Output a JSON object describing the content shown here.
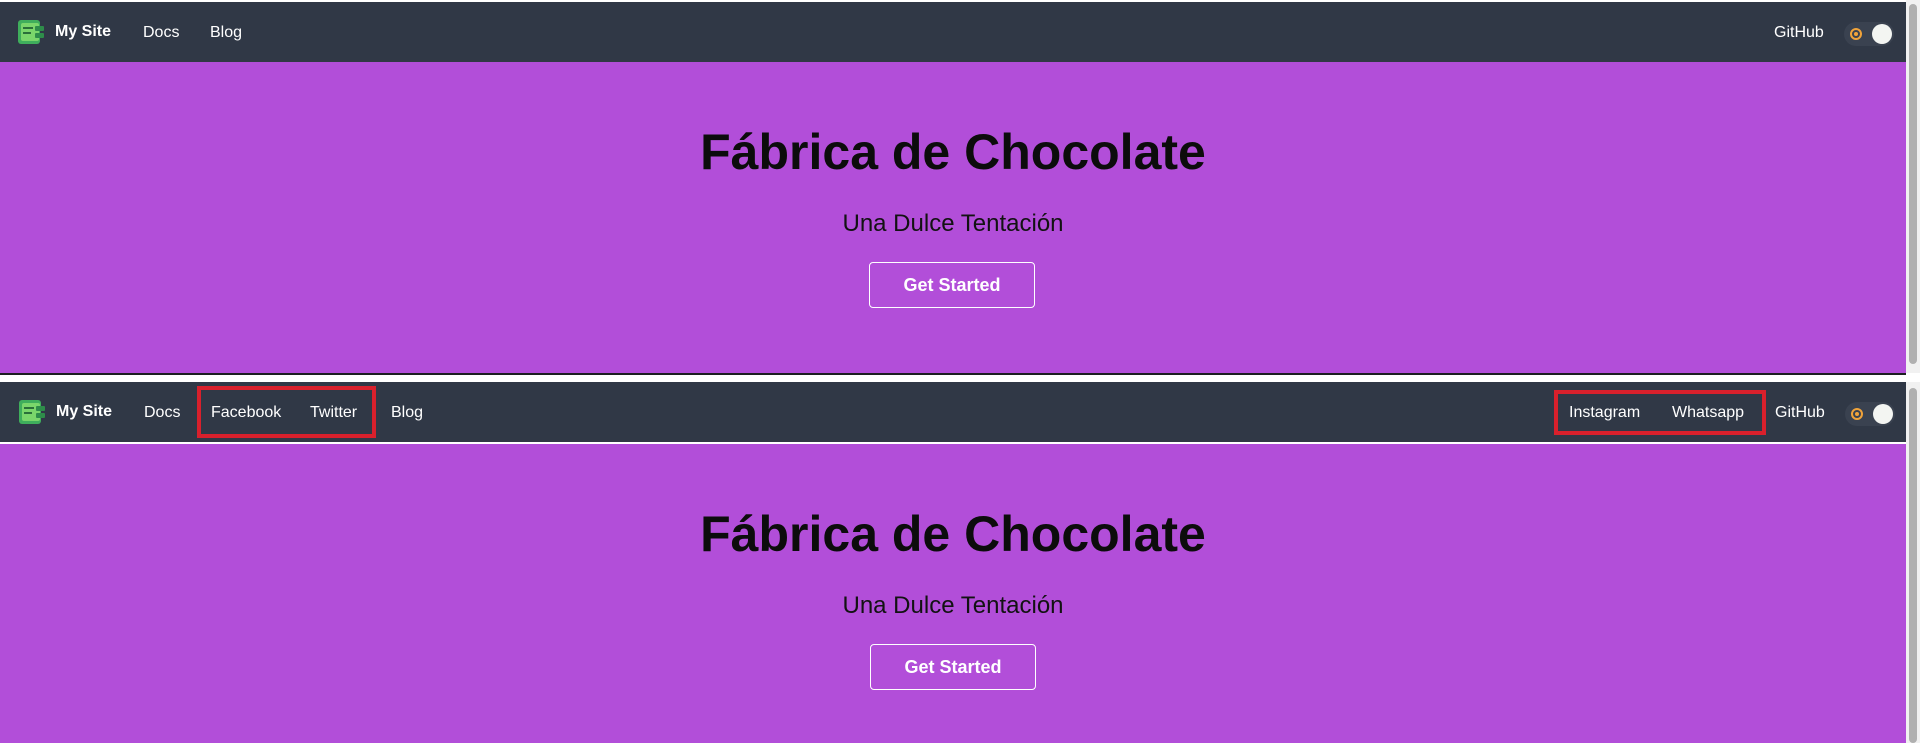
{
  "site": {
    "brand": "My Site",
    "github_label": "GitHub"
  },
  "top_view": {
    "nav_left": [
      "Docs",
      "Blog"
    ]
  },
  "bottom_view": {
    "nav_left": [
      "Docs",
      "Facebook",
      "Twitter",
      "Blog"
    ],
    "nav_right": [
      "Instagram",
      "Whatsapp"
    ]
  },
  "hero": {
    "title": "Fábrica de Chocolate",
    "subtitle": "Una Dulce Tentación",
    "button_label": "Get Started"
  },
  "colors": {
    "navbar_bg": "#303846",
    "hero_bg": "#b24ed9",
    "highlight": "#d9202c"
  },
  "icons": {
    "logo": "site-logo-icon",
    "theme_toggle": "sun-moon-toggle-icon"
  }
}
